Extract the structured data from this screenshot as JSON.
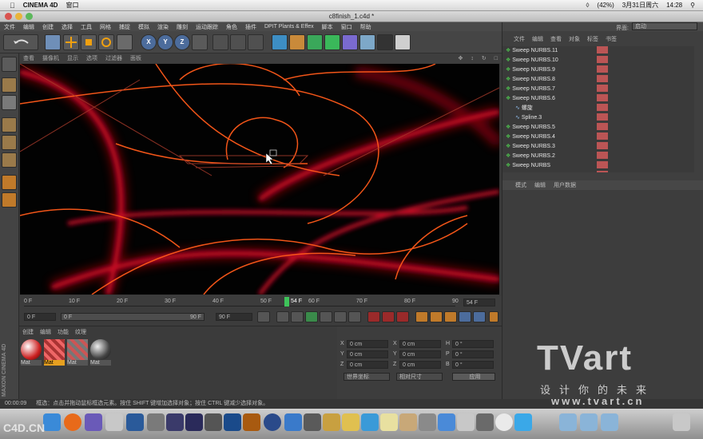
{
  "mac_menubar": {
    "apple_icon": "apple-icon",
    "app_name": "CINEMA 4D",
    "window_menu": "窗口",
    "battery": "(42%)",
    "date": "3月31日周六",
    "time": "14:28"
  },
  "window": {
    "title": "c8finish_1.c4d *"
  },
  "app_menu": [
    "文件",
    "编辑",
    "创建",
    "选择",
    "工具",
    "网格",
    "捕捉",
    "模拟",
    "渲染",
    "雕刻",
    "运动跟踪",
    "角色",
    "插件",
    "DPIT Plants & Effex",
    "脚本",
    "窗口",
    "帮助"
  ],
  "layout": {
    "label": "界面:",
    "value": "启动"
  },
  "viewport_menu": [
    "查看",
    "摄像机",
    "显示",
    "选项",
    "过滤器",
    "面板"
  ],
  "object_manager": {
    "menu": [
      "文件",
      "编辑",
      "查看",
      "对象",
      "标签",
      "书签"
    ],
    "objects": [
      "Sweep NURBS.11",
      "Sweep NURBS.10",
      "Sweep NURBS.9",
      "Sweep NURBS.8",
      "Sweep NURBS.7",
      "Sweep NURBS.6",
      "螺旋",
      "Spline.3",
      "Sweep NURBS.5",
      "Sweep NURBS.4",
      "Sweep NURBS.3",
      "Sweep NURBS.2",
      "Sweep NURBS"
    ]
  },
  "attributes": {
    "menu": [
      "模式",
      "编辑",
      "用户数据"
    ]
  },
  "timeline": {
    "ticks": [
      "0 F",
      "10 F",
      "20 F",
      "30 F",
      "40 F",
      "50 F",
      "60 F",
      "70 F",
      "80 F",
      "90"
    ],
    "current_frame_marker": "54 F",
    "end_frame": "54 F",
    "start_field": "0 F",
    "preview_start": "0 F",
    "preview_end": "90 F",
    "max_field": "90 F"
  },
  "material_manager": {
    "menu": [
      "创建",
      "编辑",
      "功能",
      "纹理"
    ],
    "materials": [
      "Mat",
      "Mat",
      "Mat",
      "Mat"
    ]
  },
  "coordinates": {
    "rows": [
      {
        "a": "X",
        "av": "0 cm",
        "b": "X",
        "bv": "0 cm",
        "c": "H",
        "cv": "0 °"
      },
      {
        "a": "Y",
        "av": "0 cm",
        "b": "Y",
        "bv": "0 cm",
        "c": "P",
        "cv": "0 °"
      },
      {
        "a": "Z",
        "av": "0 cm",
        "b": "Z",
        "bv": "0 cm",
        "c": "B",
        "cv": "0 °"
      }
    ],
    "mode1": "世界坐标",
    "mode2": "相对尺寸",
    "apply": "应用"
  },
  "status": {
    "time": "00:00:09",
    "message": "框选：点击并拖动鼠标框选元素。按住 SHIFT 键增加选择对象；按住 CTRL 键减少选择对象。"
  },
  "maxon": {
    "line1": "MAXON",
    "line2": "CINEMA 4D"
  },
  "watermark": {
    "brand": "TVart",
    "slogan": "设计你的未来",
    "url": "www.tvart.cn",
    "corner": "C4D.CN"
  }
}
